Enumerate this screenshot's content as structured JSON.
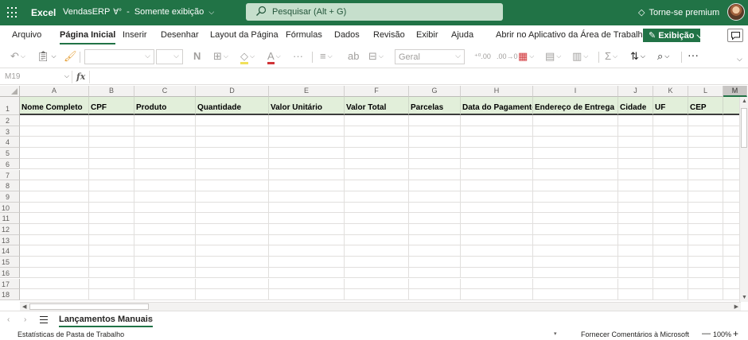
{
  "titlebar": {
    "app_name": "Excel",
    "doc_name": "VendasERP",
    "people_icon": "people-icon",
    "separator": "-",
    "mode": "Somente exibição",
    "search_placeholder": "Pesquisar (Alt + G)",
    "premium_label": "Torne-se premium",
    "premium_icon": "diamond-icon",
    "accent_color": "#217346"
  },
  "ribbon": {
    "tabs": [
      {
        "label": "Arquivo"
      },
      {
        "label": "Página Inicial",
        "active": true
      },
      {
        "label": "Inserir"
      },
      {
        "label": "Desenhar"
      },
      {
        "label": "Layout da Página"
      },
      {
        "label": "Fórmulas"
      },
      {
        "label": "Dados"
      },
      {
        "label": "Revisão"
      },
      {
        "label": "Exibir"
      },
      {
        "label": "Ajuda"
      },
      {
        "label": "Abrir no Aplicativo da Área de Trabalho"
      }
    ],
    "view_button": "Exibição"
  },
  "toolbar": {
    "bold": "N",
    "number_format": "Geral",
    "more": "···"
  },
  "formula_bar": {
    "name_box": "M19",
    "fx_label": "fx"
  },
  "grid": {
    "column_letters": [
      "A",
      "B",
      "C",
      "D",
      "E",
      "F",
      "G",
      "H",
      "I",
      "J",
      "K",
      "L",
      "M"
    ],
    "row_numbers": [
      "1",
      "2",
      "3",
      "4",
      "5",
      "6",
      "7",
      "8",
      "9",
      "10",
      "11",
      "12",
      "13",
      "14",
      "15",
      "16",
      "17",
      "18"
    ],
    "headers": [
      "Nome Completo",
      "CPF",
      "Produto",
      "Quantidade",
      "Valor Unitário",
      "Valor Total",
      "Parcelas",
      "Data do Pagamento",
      "Endereço de Entrega",
      "Cidade",
      "UF",
      "CEP",
      ""
    ],
    "header_fill": "#e2efda"
  },
  "sheets": {
    "tabs": [
      "Lançamentos Manuais"
    ],
    "add": "+"
  },
  "status": {
    "left": "Estatísticas de Pasta de Trabalho",
    "feedback": "Fornecer Comentários à Microsoft",
    "zoom_minus": "—",
    "zoom": "100%",
    "zoom_plus": "+"
  }
}
